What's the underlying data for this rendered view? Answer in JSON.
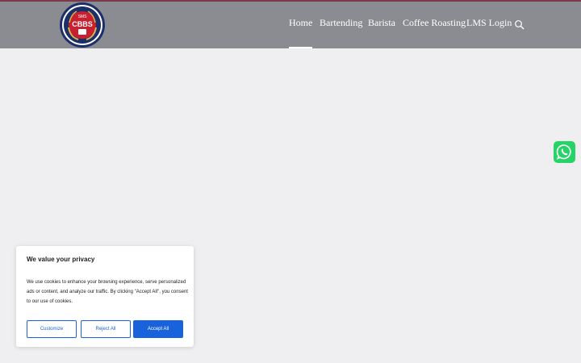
{
  "brand": {
    "logo_text": "CBBS",
    "logo_sub": "SMS"
  },
  "nav": {
    "items": [
      {
        "label": "Home",
        "active": true
      },
      {
        "label": "Bartending",
        "active": false
      },
      {
        "label": "Barista",
        "active": false
      },
      {
        "label": "Coffee Roasting",
        "active": false
      },
      {
        "label": "LMS Login",
        "active": false
      }
    ],
    "search_icon": "search-icon"
  },
  "colors": {
    "header_bg": "#8a8c91",
    "accent_line": "#7a3a4a",
    "page_bg": "#efeff1",
    "button_blue": "#1863dc",
    "whatsapp_green": "#25d366"
  },
  "whatsapp": {
    "icon": "whatsapp-icon"
  },
  "cookie_banner": {
    "title": "We value your privacy",
    "text": "We use cookies to enhance your browsing experience, serve personalized ads or content, and analyze our traffic. By clicking \"Accept All\", you consent to our use of cookies.",
    "customize_label": "Customize",
    "reject_label": "Reject All",
    "accept_label": "Accept All"
  }
}
